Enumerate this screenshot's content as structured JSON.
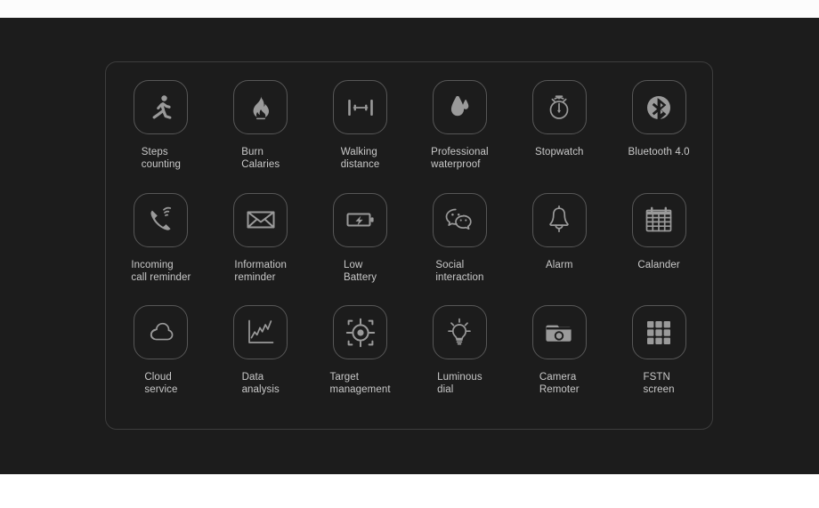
{
  "page": {
    "background_color": "#1c1c1c",
    "band_color": "#ffffff",
    "panel_border_color": "#3d3d3d",
    "icon_color": "#9a9a9a",
    "label_color": "#c9c9c9"
  },
  "features": [
    {
      "icon": "running-person-icon",
      "label": "Steps\ncounting"
    },
    {
      "icon": "flame-icon",
      "label": "Burn\nCalaries"
    },
    {
      "icon": "distance-ruler-icon",
      "label": "Walking\ndistance"
    },
    {
      "icon": "water-drop-icon",
      "label": "Professional\nwaterproof"
    },
    {
      "icon": "stopwatch-icon",
      "label": "Stopwatch"
    },
    {
      "icon": "bluetooth-icon",
      "label": "Bluetooth 4.0"
    },
    {
      "icon": "ringing-phone-icon",
      "label": "Incoming\ncall reminder"
    },
    {
      "icon": "envelope-icon",
      "label": "Information\nreminder"
    },
    {
      "icon": "low-battery-icon",
      "label": "Low\nBattery"
    },
    {
      "icon": "chat-bubbles-icon",
      "label": "Social\ninteraction"
    },
    {
      "icon": "bell-icon",
      "label": "Alarm"
    },
    {
      "icon": "calendar-icon",
      "label": "Calander"
    },
    {
      "icon": "cloud-icon",
      "label": "Cloud\nservice"
    },
    {
      "icon": "line-chart-icon",
      "label": "Data\nanalysis"
    },
    {
      "icon": "target-crosshair-icon",
      "label": "Target\nmanagement"
    },
    {
      "icon": "lightbulb-icon",
      "label": "Luminous\ndial"
    },
    {
      "icon": "camera-icon",
      "label": "Camera\nRemoter"
    },
    {
      "icon": "grid-screen-icon",
      "label": "FSTN\nscreen"
    }
  ]
}
